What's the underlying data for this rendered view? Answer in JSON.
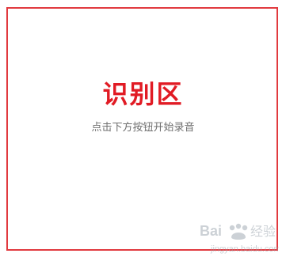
{
  "recognition_area": {
    "title": "识别区",
    "instruction": "点击下方按钮开始录音"
  },
  "watermark": {
    "text": "Bai 经验",
    "subtext": "jingyan.baidu.com"
  },
  "colors": {
    "frame_border": "#e13a3f",
    "title": "#e11b24",
    "instruction": "#6f6f6f",
    "background": "#ffffff"
  }
}
